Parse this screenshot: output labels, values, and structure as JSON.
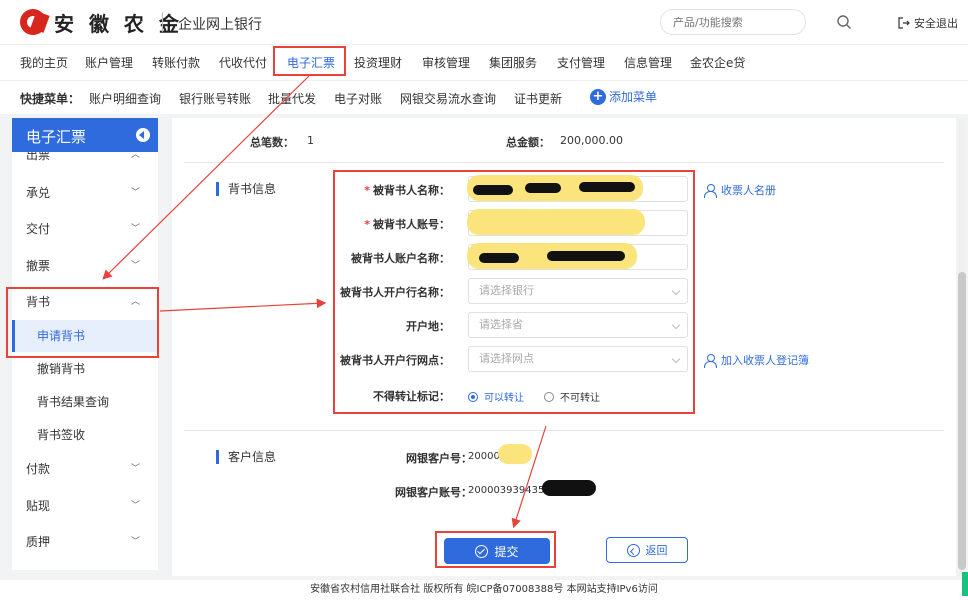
{
  "header": {
    "brand": "安 徽 农 金",
    "subbrand": "企业网上银行",
    "search_placeholder": "产品/功能搜索",
    "logout": "安全退出"
  },
  "nav": {
    "items": [
      "我的主页",
      "账户管理",
      "转账付款",
      "代收代付",
      "电子汇票",
      "投资理财",
      "审核管理",
      "集团服务",
      "支付管理",
      "信息管理",
      "金农企e贷"
    ],
    "active_index": 4
  },
  "shortcut": {
    "label": "快捷菜单：",
    "items": [
      "账户明细查询",
      "银行账号转账",
      "批量代发",
      "电子对账",
      "网银交易流水查询",
      "证书更新"
    ],
    "add_label": "添加菜单"
  },
  "sidebar": {
    "title": "电子汇票",
    "items": [
      {
        "label": "出票"
      },
      {
        "label": "承兑"
      },
      {
        "label": "交付"
      },
      {
        "label": "撤票"
      },
      {
        "label": "背书"
      }
    ],
    "sub_items": [
      "申请背书",
      "撤销背书",
      "背书结果查询",
      "背书签收"
    ],
    "more_items": [
      {
        "label": "付款"
      },
      {
        "label": "贴现"
      },
      {
        "label": "质押"
      }
    ]
  },
  "summary": {
    "count_label": "总笔数：",
    "count_value": "1",
    "amount_label": "总金额：",
    "amount_value": "200,000.00"
  },
  "endorse": {
    "section_title": "背书信息",
    "fields": {
      "name_label": "被背书人名称：",
      "account_label": "被背书人账号：",
      "account_name_label": "被背书人账户名称：",
      "bank_label": "被背书人开户行名称：",
      "bank_placeholder": "请选择银行",
      "location_label": "开户地：",
      "location_placeholder": "请选择省",
      "branch_label": "被背书人开户行网点：",
      "branch_placeholder": "请选择网点",
      "transfer_label": "不得转让标记："
    },
    "transfer_options": [
      "可以转让",
      "不可转让"
    ],
    "payee_book": "收票人名册",
    "add_payee": "加入收票人登记簿"
  },
  "customer": {
    "section_title": "客户信息",
    "number_label": "网银客户号：",
    "number_value": "200003",
    "account_label": "网银客户账号：",
    "account_value": "2000039394351"
  },
  "actions": {
    "submit": "提交",
    "back": "返回"
  },
  "footer": "安徽省农村信用社联合社 版权所有 皖ICP备07008388号 本网站支持IPv6访问",
  "colors": {
    "primary": "#2f6bdc",
    "annotation": "#e8423a",
    "brand_red": "#d7261e",
    "redaction": "#fbe47c"
  }
}
